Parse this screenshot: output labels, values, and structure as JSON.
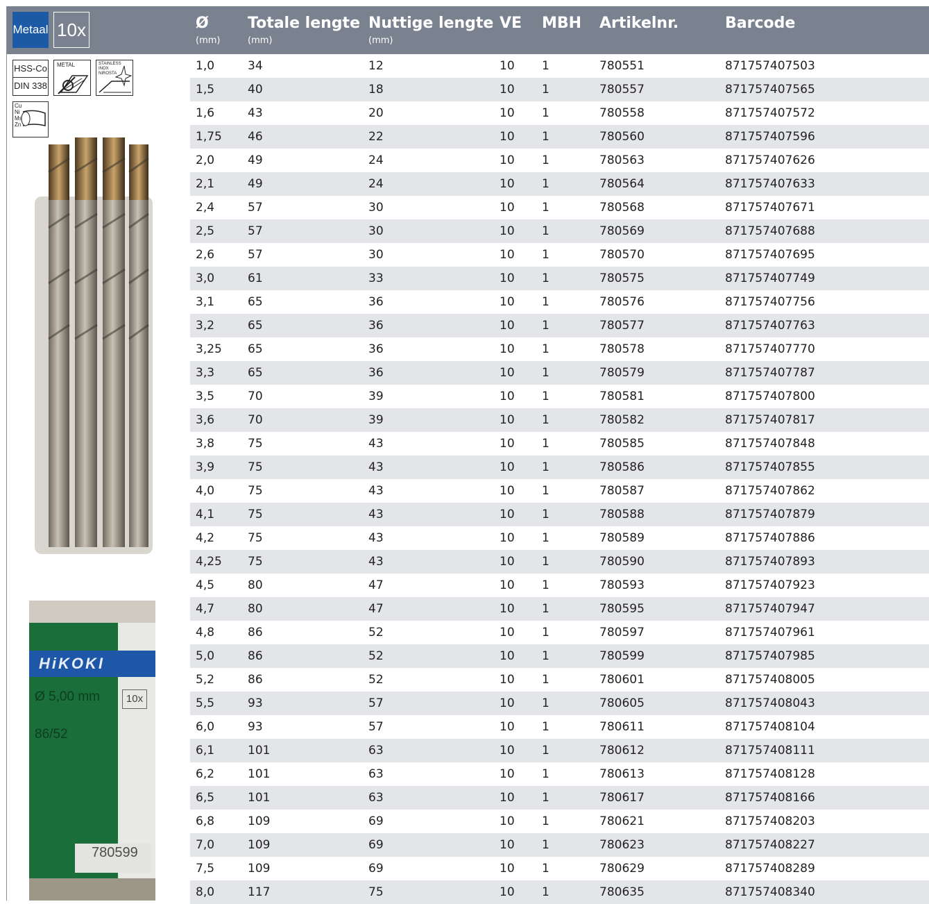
{
  "header": {
    "badge_metaal": "Metaal",
    "badge_pack": "10x",
    "columns": [
      {
        "title": "Ø",
        "unit": "(mm)"
      },
      {
        "title": "Totale lengte",
        "unit": "(mm)"
      },
      {
        "title": "Nuttige lengte",
        "unit": "(mm)"
      },
      {
        "title": "VE",
        "unit": ""
      },
      {
        "title": "MBH",
        "unit": ""
      },
      {
        "title": "Artikelnr.",
        "unit": ""
      },
      {
        "title": "Barcode",
        "unit": ""
      }
    ]
  },
  "icons": {
    "hss_co": "HSS-Co",
    "din": "DIN 338",
    "metal": "METAL",
    "stainless_1": "STAINLESS",
    "stainless_2": "INOX",
    "stainless_3": "NIROSTA",
    "nonferrous": [
      "Cu",
      "Ni",
      "Ms",
      "Zn"
    ]
  },
  "package": {
    "brand": "HiKOKI",
    "size": "Ø 5,00 mm",
    "lengths": "86/52",
    "pack": "10x",
    "article": "780599"
  },
  "rows": [
    [
      "1,0",
      "34",
      "12",
      "10",
      "1",
      "780551",
      "871757407503"
    ],
    [
      "1,5",
      "40",
      "18",
      "10",
      "1",
      "780557",
      "871757407565"
    ],
    [
      "1,6",
      "43",
      "20",
      "10",
      "1",
      "780558",
      "871757407572"
    ],
    [
      "1,75",
      "46",
      "22",
      "10",
      "1",
      "780560",
      "871757407596"
    ],
    [
      "2,0",
      "49",
      "24",
      "10",
      "1",
      "780563",
      "871757407626"
    ],
    [
      "2,1",
      "49",
      "24",
      "10",
      "1",
      "780564",
      "871757407633"
    ],
    [
      "2,4",
      "57",
      "30",
      "10",
      "1",
      "780568",
      "871757407671"
    ],
    [
      "2,5",
      "57",
      "30",
      "10",
      "1",
      "780569",
      "871757407688"
    ],
    [
      "2,6",
      "57",
      "30",
      "10",
      "1",
      "780570",
      "871757407695"
    ],
    [
      "3,0",
      "61",
      "33",
      "10",
      "1",
      "780575",
      "871757407749"
    ],
    [
      "3,1",
      "65",
      "36",
      "10",
      "1",
      "780576",
      "871757407756"
    ],
    [
      "3,2",
      "65",
      "36",
      "10",
      "1",
      "780577",
      "871757407763"
    ],
    [
      "3,25",
      "65",
      "36",
      "10",
      "1",
      "780578",
      "871757407770"
    ],
    [
      "3,3",
      "65",
      "36",
      "10",
      "1",
      "780579",
      "871757407787"
    ],
    [
      "3,5",
      "70",
      "39",
      "10",
      "1",
      "780581",
      "871757407800"
    ],
    [
      "3,6",
      "70",
      "39",
      "10",
      "1",
      "780582",
      "871757407817"
    ],
    [
      "3,8",
      "75",
      "43",
      "10",
      "1",
      "780585",
      "871757407848"
    ],
    [
      "3,9",
      "75",
      "43",
      "10",
      "1",
      "780586",
      "871757407855"
    ],
    [
      "4,0",
      "75",
      "43",
      "10",
      "1",
      "780587",
      "871757407862"
    ],
    [
      "4,1",
      "75",
      "43",
      "10",
      "1",
      "780588",
      "871757407879"
    ],
    [
      "4,2",
      "75",
      "43",
      "10",
      "1",
      "780589",
      "871757407886"
    ],
    [
      "4,25",
      "75",
      "43",
      "10",
      "1",
      "780590",
      "871757407893"
    ],
    [
      "4,5",
      "80",
      "47",
      "10",
      "1",
      "780593",
      "871757407923"
    ],
    [
      "4,7",
      "80",
      "47",
      "10",
      "1",
      "780595",
      "871757407947"
    ],
    [
      "4,8",
      "86",
      "52",
      "10",
      "1",
      "780597",
      "871757407961"
    ],
    [
      "5,0",
      "86",
      "52",
      "10",
      "1",
      "780599",
      "871757407985"
    ],
    [
      "5,2",
      "86",
      "52",
      "10",
      "1",
      "780601",
      "871757408005"
    ],
    [
      "5,5",
      "93",
      "57",
      "10",
      "1",
      "780605",
      "871757408043"
    ],
    [
      "6,0",
      "93",
      "57",
      "10",
      "1",
      "780611",
      "871757408104"
    ],
    [
      "6,1",
      "101",
      "63",
      "10",
      "1",
      "780612",
      "871757408111"
    ],
    [
      "6,2",
      "101",
      "63",
      "10",
      "1",
      "780613",
      "871757408128"
    ],
    [
      "6,5",
      "101",
      "63",
      "10",
      "1",
      "780617",
      "871757408166"
    ],
    [
      "6,8",
      "109",
      "69",
      "10",
      "1",
      "780621",
      "871757408203"
    ],
    [
      "7,0",
      "109",
      "69",
      "10",
      "1",
      "780623",
      "871757408227"
    ],
    [
      "7,5",
      "109",
      "69",
      "10",
      "1",
      "780629",
      "871757408289"
    ],
    [
      "8,0",
      "117",
      "75",
      "10",
      "1",
      "780635",
      "871757408340"
    ]
  ]
}
